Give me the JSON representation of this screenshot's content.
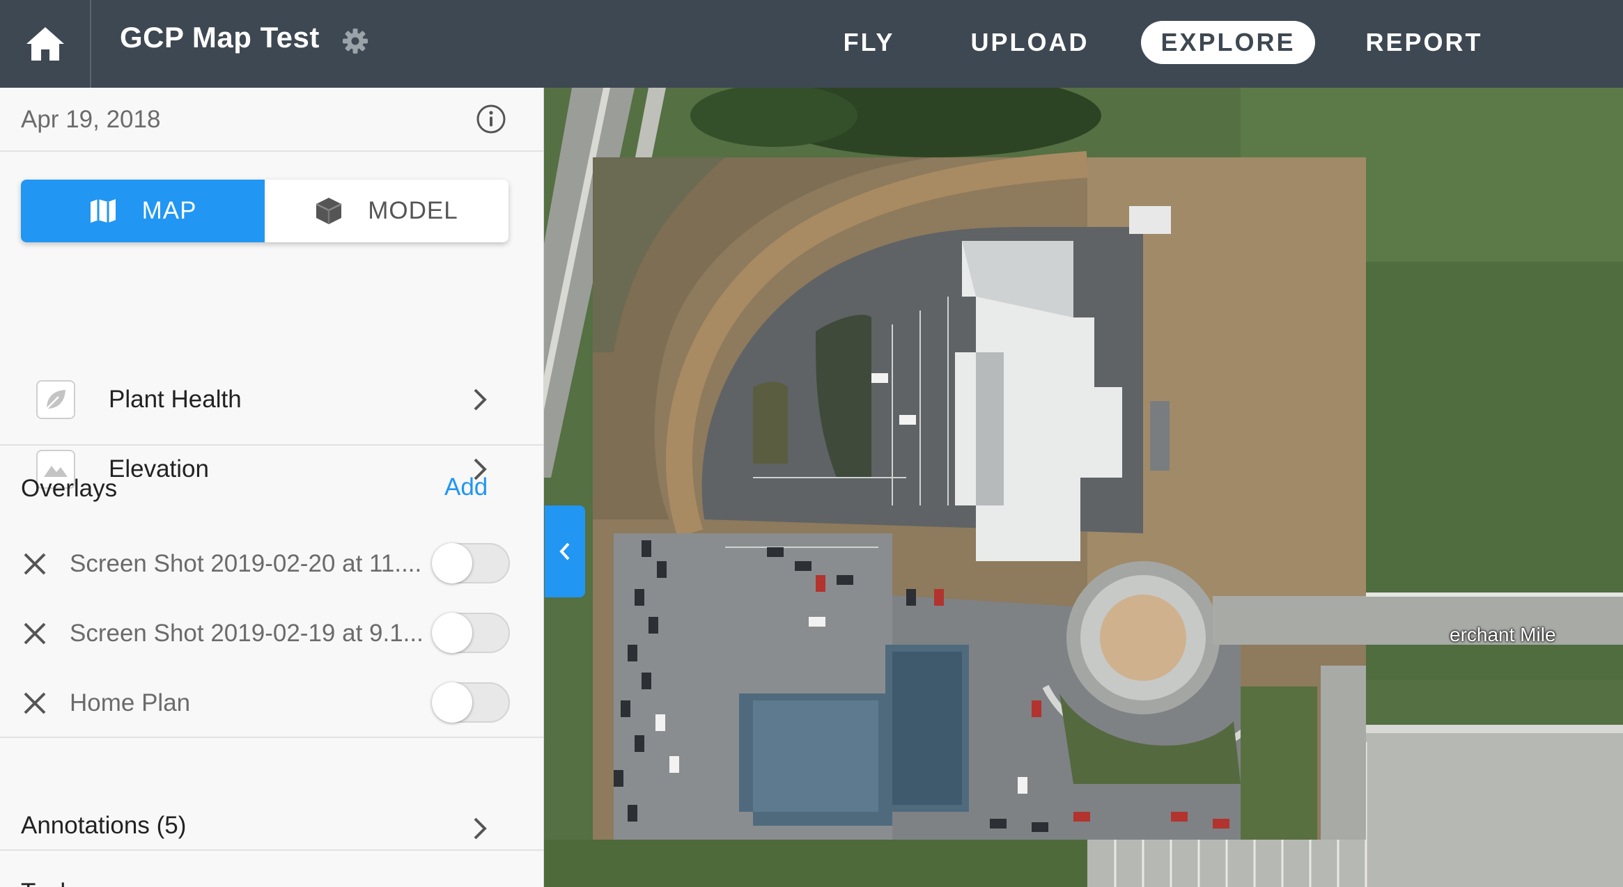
{
  "header": {
    "project_title": "GCP Map Test",
    "icons": {
      "home": "home-icon",
      "settings": "gear-icon"
    },
    "nav": [
      {
        "label": "FLY",
        "active": false
      },
      {
        "label": "UPLOAD",
        "active": false
      },
      {
        "label": "EXPLORE",
        "active": true
      },
      {
        "label": "REPORT",
        "active": false
      }
    ]
  },
  "sidebar": {
    "date": "Apr 19, 2018",
    "view_toggle": {
      "map_label": "MAP",
      "model_label": "MODEL",
      "selected": "MAP"
    },
    "layers": [
      {
        "label": "Plant Health",
        "icon": "leaf-icon"
      },
      {
        "label": "Elevation",
        "icon": "mountain-icon"
      }
    ],
    "overlays": {
      "title": "Overlays",
      "add_label": "Add",
      "items": [
        {
          "name": "Screen Shot 2019-02-20 at 11....",
          "enabled": false
        },
        {
          "name": "Screen Shot 2019-02-19 at 9.1...",
          "enabled": false
        },
        {
          "name": "Home Plan",
          "enabled": false
        }
      ]
    },
    "annotations_label": "Annotations (5)",
    "tools_label": "Tools"
  },
  "map": {
    "street_label": "erchant Mile"
  },
  "colors": {
    "header_bg": "#3e4852",
    "accent_blue": "#2196f3",
    "sidebar_bg": "#f8f8f8"
  }
}
